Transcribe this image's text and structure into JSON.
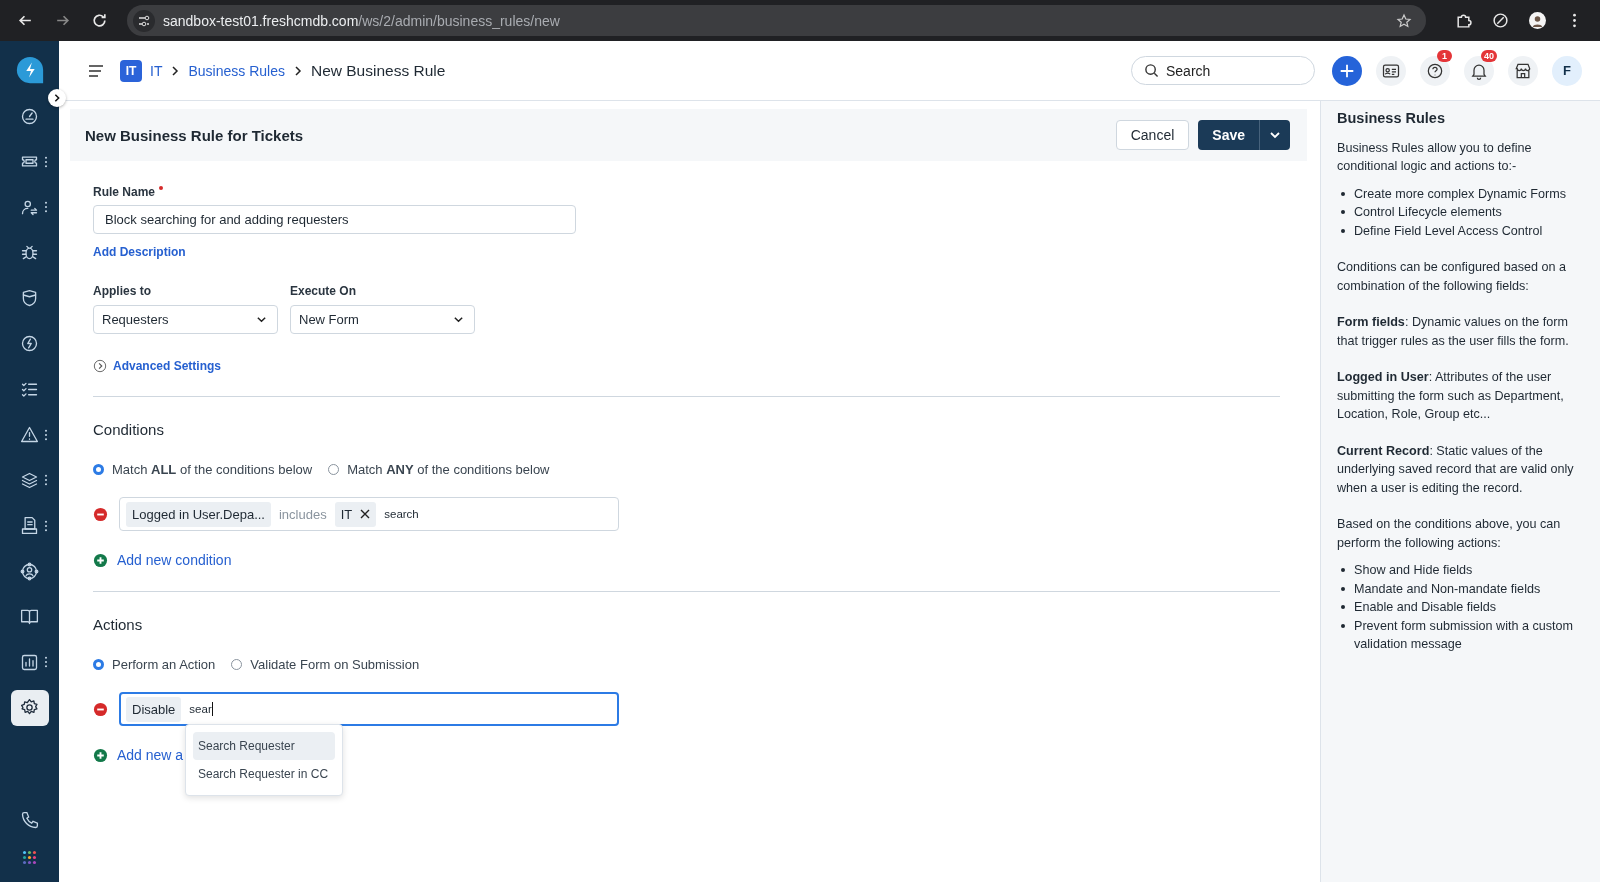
{
  "browser": {
    "url_host": "sandbox-test01.freshcmdb.com",
    "url_path": "/ws/2/admin/business_rules/new"
  },
  "sidebar": {
    "items": [
      {
        "kind": "gauge",
        "has_menu": false,
        "selected": false
      },
      {
        "kind": "ticket",
        "has_menu": true,
        "selected": false
      },
      {
        "kind": "user-swap",
        "has_menu": true,
        "selected": false
      },
      {
        "kind": "bug",
        "has_menu": false,
        "selected": false
      },
      {
        "kind": "shield",
        "has_menu": false,
        "selected": false
      },
      {
        "kind": "bolt",
        "has_menu": false,
        "selected": false
      },
      {
        "kind": "checklist",
        "has_menu": false,
        "selected": false
      },
      {
        "kind": "warning",
        "has_menu": true,
        "selected": false
      },
      {
        "kind": "layers",
        "has_menu": true,
        "selected": false
      },
      {
        "kind": "document",
        "has_menu": true,
        "selected": false
      },
      {
        "kind": "user-circle",
        "has_menu": false,
        "selected": false
      },
      {
        "kind": "book",
        "has_menu": false,
        "selected": false
      },
      {
        "kind": "chart",
        "has_menu": true,
        "selected": false
      },
      {
        "kind": "gear",
        "has_menu": false,
        "selected": true
      }
    ]
  },
  "header": {
    "workspace_badge": "IT",
    "breadcrumb": [
      {
        "label": "IT",
        "kind": "link"
      },
      {
        "label": "Business Rules",
        "kind": "link"
      },
      {
        "label": "New Business Rule",
        "kind": "current"
      }
    ],
    "search": {
      "placeholder": "Search"
    },
    "help_count": "1",
    "notification_count": "40",
    "avatar": "F"
  },
  "page": {
    "title": "New Business Rule for Tickets",
    "buttons": [
      {
        "label": "Cancel",
        "kind": "secondary"
      },
      {
        "label": "Save",
        "kind": "primary"
      }
    ]
  },
  "form": {
    "rule_name": {
      "label": "Rule Name",
      "required": true,
      "value": "Block searching for and adding requesters"
    },
    "add_description": "Add Description",
    "selects": [
      {
        "label": "Applies to",
        "value": "Requesters"
      },
      {
        "label": "Execute On",
        "value": "New Form"
      }
    ],
    "advanced_settings": "Advanced Settings"
  },
  "conditions": {
    "title": "Conditions",
    "options": [
      {
        "label": "Match **ALL** of the conditions below",
        "selected": true
      },
      {
        "label": "Match **ANY** of the conditions below",
        "selected": false
      }
    ],
    "rows": [
      {
        "field": "Logged in User.Depa...",
        "operator": "includes",
        "values": [
          "IT"
        ],
        "input": "search"
      }
    ],
    "add": "Add new condition"
  },
  "actions": {
    "title": "Actions",
    "options": [
      {
        "label": "Perform an Action",
        "selected": true
      },
      {
        "label": "Validate Form on Submission",
        "selected": false
      }
    ],
    "rows": [
      {
        "action": "Disable",
        "input": "sear",
        "focused": true
      }
    ],
    "suggestions": [
      {
        "label": "Search Requester",
        "selected": true
      },
      {
        "label": "Search Requester in CC",
        "selected": false
      }
    ],
    "add": "Add new a"
  },
  "help": {
    "title": "Business Rules",
    "blocks": [
      {
        "kind": "para",
        "text": "Business Rules allow you to define conditional logic and actions to:-"
      },
      {
        "kind": "list",
        "items": [
          "Create more complex Dynamic Forms",
          "Control Lifecycle elements",
          "Define Field Level Access Control"
        ]
      },
      {
        "kind": "para",
        "text": "Conditions can be configured based on a combination of the following fields:"
      },
      {
        "kind": "para",
        "text": "**Form fields**: Dynamic values on the form that trigger rules as the user fills the form."
      },
      {
        "kind": "para",
        "text": "**Logged in User**: Attributes of the user submitting the form such as Department, Location, Role, Group etc..."
      },
      {
        "kind": "para",
        "text": "**Current Record**: Static values of the underlying saved record that are valid only when a user is editing the record."
      },
      {
        "kind": "para",
        "text": "Based on the conditions above, you can perform the following actions:"
      },
      {
        "kind": "list",
        "items": [
          "Show and Hide fields",
          "Mandate and Non-mandate fields",
          "Enable and Disable fields",
          "Prevent form submission with a custom validation message"
        ]
      }
    ]
  }
}
